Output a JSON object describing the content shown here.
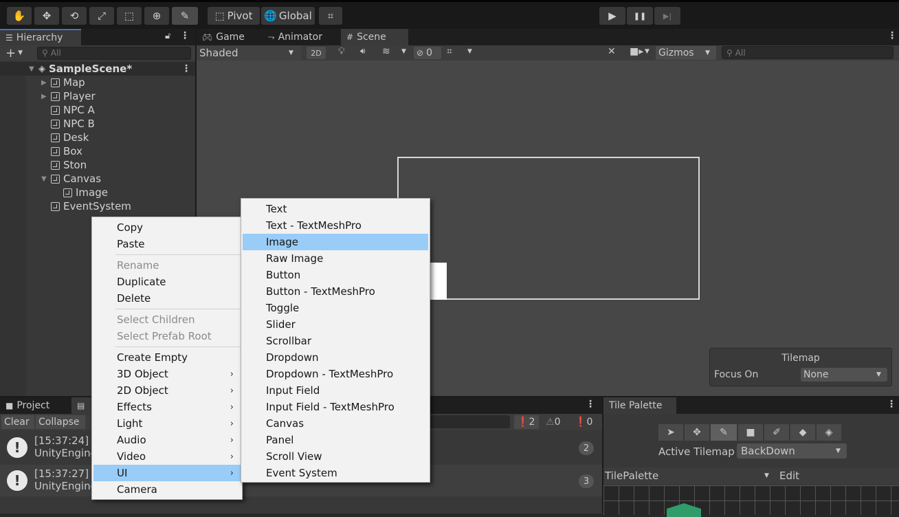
{
  "toolbar": {
    "tools": [
      "hand-tool",
      "move-tool",
      "rotate-tool",
      "scale-tool",
      "rect-tool",
      "transform-tool",
      "brush-tool"
    ],
    "pivot_label": "Pivot",
    "global_label": "Global",
    "play_icon": "▶",
    "pause_icon": "❚❚",
    "step_icon": "▶|"
  },
  "hierarchy": {
    "tab_label": "Hierarchy",
    "add_label": "+",
    "search_placeholder": "All",
    "scene_name": "SampleScene*",
    "items": [
      {
        "label": "Map",
        "expandable": true,
        "indent": 1
      },
      {
        "label": "Player",
        "expandable": true,
        "indent": 1
      },
      {
        "label": "NPC A",
        "indent": 1
      },
      {
        "label": "NPC B",
        "indent": 1
      },
      {
        "label": "Desk",
        "indent": 1
      },
      {
        "label": "Box",
        "indent": 1
      },
      {
        "label": "Ston",
        "indent": 1
      },
      {
        "label": "Canvas",
        "expanded": true,
        "indent": 1
      },
      {
        "label": "Image",
        "indent": 2
      },
      {
        "label": "EventSystem",
        "indent": 1
      }
    ]
  },
  "scene_tabs": {
    "game": "Game",
    "animator": "Animator",
    "scene": "Scene"
  },
  "scene_toolbar": {
    "shading": "Shaded",
    "mode_2d": "2D",
    "hidden_count": "0",
    "gizmos": "Gizmos",
    "search_placeholder": "All"
  },
  "tilemap_overlay": {
    "title": "Tilemap",
    "focus_label": "Focus On",
    "focus_value": "None"
  },
  "bottom_tabs": {
    "project": "Project"
  },
  "console": {
    "clear": "Clear",
    "collapse": "Collapse",
    "error_count": "2",
    "warning_count": "0",
    "info_count": "0",
    "rows": [
      {
        "time": "[15:37:24] T",
        "source": "UnityEngine",
        "count": "2"
      },
      {
        "time": "[15:37:27] T",
        "source": "UnityEngine",
        "count": "3"
      }
    ]
  },
  "tile_palette": {
    "tab_label": "Tile Palette",
    "active_tilemap_label": "Active Tilemap",
    "active_tilemap_value": "BackDown",
    "palette_name": "TilePalette",
    "edit_label": "Edit"
  },
  "context_menu": {
    "items": [
      {
        "label": "Copy"
      },
      {
        "label": "Paste"
      },
      {
        "sep": true
      },
      {
        "label": "Rename",
        "disabled": true
      },
      {
        "label": "Duplicate"
      },
      {
        "label": "Delete"
      },
      {
        "sep": true
      },
      {
        "label": "Select Children",
        "disabled": true
      },
      {
        "label": "Select Prefab Root",
        "disabled": true
      },
      {
        "sep": true
      },
      {
        "label": "Create Empty"
      },
      {
        "label": "3D Object",
        "submenu": true
      },
      {
        "label": "2D Object",
        "submenu": true
      },
      {
        "label": "Effects",
        "submenu": true
      },
      {
        "label": "Light",
        "submenu": true
      },
      {
        "label": "Audio",
        "submenu": true
      },
      {
        "label": "Video",
        "submenu": true
      },
      {
        "label": "UI",
        "submenu": true,
        "highlight": true
      },
      {
        "label": "Camera"
      }
    ]
  },
  "ui_submenu": {
    "items": [
      {
        "label": "Text"
      },
      {
        "label": "Text - TextMeshPro"
      },
      {
        "label": "Image",
        "highlight": true
      },
      {
        "label": "Raw Image"
      },
      {
        "label": "Button"
      },
      {
        "label": "Button - TextMeshPro"
      },
      {
        "label": "Toggle"
      },
      {
        "label": "Slider"
      },
      {
        "label": "Scrollbar"
      },
      {
        "label": "Dropdown"
      },
      {
        "label": "Dropdown - TextMeshPro"
      },
      {
        "label": "Input Field"
      },
      {
        "label": "Input Field - TextMeshPro"
      },
      {
        "label": "Canvas"
      },
      {
        "label": "Panel"
      },
      {
        "label": "Scroll View"
      },
      {
        "label": "Event System"
      }
    ]
  },
  "colors": {
    "menu_highlight": "#99ccf7",
    "panel_bg": "#383838",
    "toolbar_bg": "#191919"
  }
}
